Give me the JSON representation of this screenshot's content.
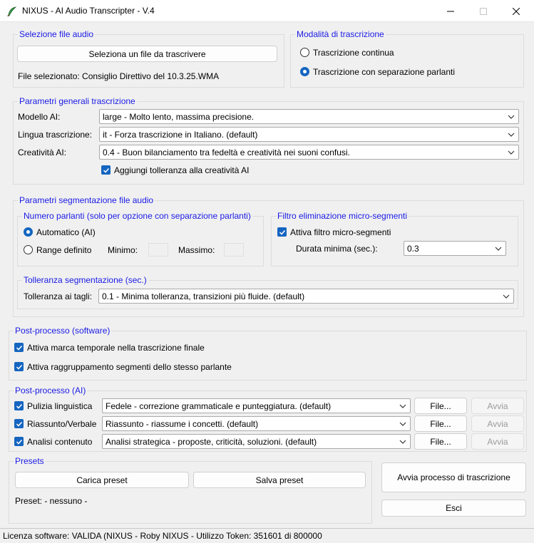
{
  "window": {
    "title": "NIXUS - AI Audio Transcripter - V.4",
    "minimize_icon": "minimize-icon",
    "maximize_icon": "maximize-icon",
    "close_icon": "close-icon"
  },
  "file_section": {
    "legend": "Selezione file audio",
    "select_button": "Seleziona un file da trascrivere",
    "selected_label": "File selezionato: Consiglio Direttivo del 10.3.25.WMA"
  },
  "mode_section": {
    "legend": "Modalità di trascrizione",
    "options": [
      {
        "label": "Trascrizione continua",
        "checked": false
      },
      {
        "label": "Trascrizione con separazione parlanti",
        "checked": true
      }
    ]
  },
  "general_params": {
    "legend": "Parametri generali trascrizione",
    "model_label": "Modello AI:",
    "model_value": "large - Molto lento, massima precisione.",
    "language_label": "Lingua trascrizione:",
    "language_value": "it - Forza trascrizione in Italiano. (default)",
    "creativity_label": "Creatività AI:",
    "creativity_value": "0.4 - Buon bilanciamento tra fedeltà e creatività nei suoni confusi.",
    "tolerance_checkbox": "Aggiungi tolleranza alla creatività AI",
    "tolerance_checked": true
  },
  "segmentation": {
    "legend": "Parametri segmentazione file audio",
    "speakers": {
      "legend": "Numero parlanti (solo per opzione con separazione parlanti)",
      "auto_label": "Automatico (AI)",
      "auto_checked": true,
      "range_label": "Range definito",
      "range_checked": false,
      "min_label": "Minimo:",
      "max_label": "Massimo:"
    },
    "filter": {
      "legend": "Filtro eliminazione micro-segmenti",
      "enable_label": "Attiva filtro micro-segmenti",
      "enable_checked": true,
      "duration_label": "Durata minima (sec.):",
      "duration_value": "0.3"
    },
    "tolerance": {
      "legend": "Tolleranza segmentazione (sec.)",
      "label": "Tolleranza ai tagli:",
      "value": "0.1 - Minima tolleranza, transizioni più fluide. (default)"
    }
  },
  "postprocess_sw": {
    "legend": "Post-processo (software)",
    "items": [
      {
        "label": "Attiva marca temporale nella trascrizione finale",
        "checked": true
      },
      {
        "label": "Attiva raggruppamento segmenti dello stesso parlante",
        "checked": true
      }
    ]
  },
  "postprocess_ai": {
    "legend": "Post-processo (AI)",
    "rows": [
      {
        "label": "Pulizia linguistica",
        "checked": true,
        "value": "Fedele - correzione grammaticale e punteggiatura. (default)",
        "file_button": "File...",
        "run_button": "Avvia"
      },
      {
        "label": "Riassunto/Verbale",
        "checked": true,
        "value": "Riassunto - riassume i concetti. (default)",
        "file_button": "File...",
        "run_button": "Avvia"
      },
      {
        "label": "Analisi contenuto",
        "checked": true,
        "value": "Analisi strategica - proposte, criticità, soluzioni. (default)",
        "file_button": "File...",
        "run_button": "Avvia"
      }
    ]
  },
  "presets": {
    "legend": "Presets",
    "load_button": "Carica preset",
    "save_button": "Salva preset",
    "current": "Preset: - nessuno -"
  },
  "actions": {
    "start_button": "Avvia processo di trascrizione",
    "exit_button": "Esci"
  },
  "status": {
    "text": "Licenza software: VALIDA (NIXUS - Roby NIXUS - Utilizzo Token: 351601 di 800000"
  },
  "colors": {
    "legend": "#1a1ae6",
    "accent": "#1565c0",
    "background": "#f0f0f0"
  }
}
